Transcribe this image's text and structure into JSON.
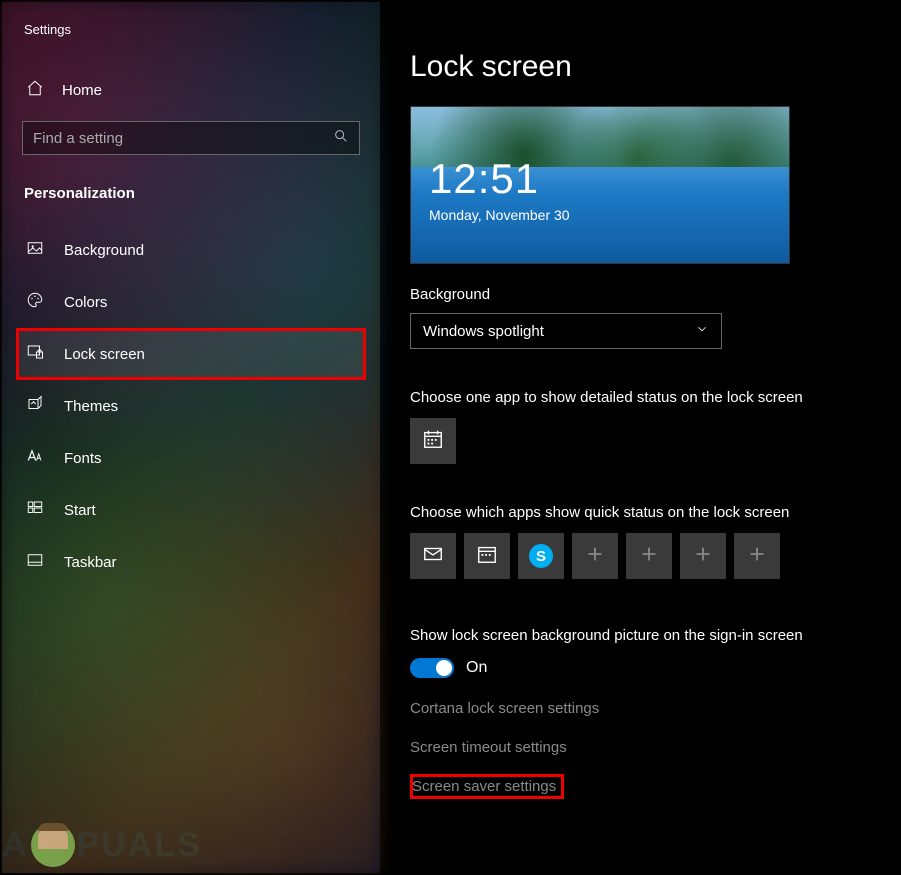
{
  "app_title": "Settings",
  "home_label": "Home",
  "search": {
    "placeholder": "Find a setting"
  },
  "section": "Personalization",
  "nav": [
    {
      "label": "Background"
    },
    {
      "label": "Colors"
    },
    {
      "label": "Lock screen"
    },
    {
      "label": "Themes"
    },
    {
      "label": "Fonts"
    },
    {
      "label": "Start"
    },
    {
      "label": "Taskbar"
    }
  ],
  "page": {
    "title": "Lock screen",
    "preview": {
      "time": "12:51",
      "date": "Monday, November 30"
    },
    "bg_label": "Background",
    "bg_value": "Windows spotlight",
    "detailed_label": "Choose one app to show detailed status on the lock screen",
    "quick_label": "Choose which apps show quick status on the lock screen",
    "signin_label": "Show lock screen background picture on the sign-in screen",
    "toggle_state": "On",
    "links": {
      "cortana": "Cortana lock screen settings",
      "timeout": "Screen timeout settings",
      "saver": "Screen saver settings"
    }
  },
  "watermark": {
    "before": "A",
    "after": "PUALS"
  }
}
